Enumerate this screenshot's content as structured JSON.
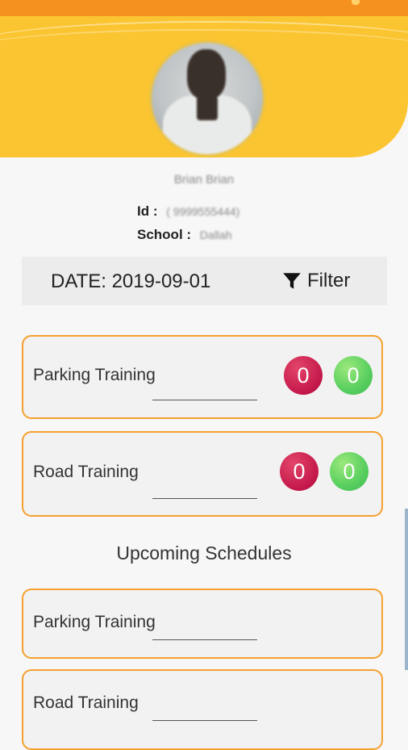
{
  "profile": {
    "name": "Brian Brian",
    "id_label": "Id :",
    "id_value": "( 9999555444)",
    "school_label": "School :",
    "school_value": "Dallah"
  },
  "date_bar": {
    "date_text": "DATE: 2019-09-01",
    "filter_label": "Filter"
  },
  "today": [
    {
      "label": "Parking Training",
      "count_red": "0",
      "count_green": "0"
    },
    {
      "label": "Road Training",
      "count_red": "0",
      "count_green": "0"
    }
  ],
  "upcoming": {
    "title": "Upcoming Schedules",
    "items": [
      {
        "label": "Parking Training"
      },
      {
        "label": "Road Training"
      }
    ]
  },
  "icons": {
    "filter": "filter-funnel-icon"
  },
  "colors": {
    "header": "#fbc531",
    "topbar": "#f5911e",
    "card_border": "#f5a02e",
    "badge_red": "#c3174a",
    "badge_green": "#58cf5f"
  }
}
